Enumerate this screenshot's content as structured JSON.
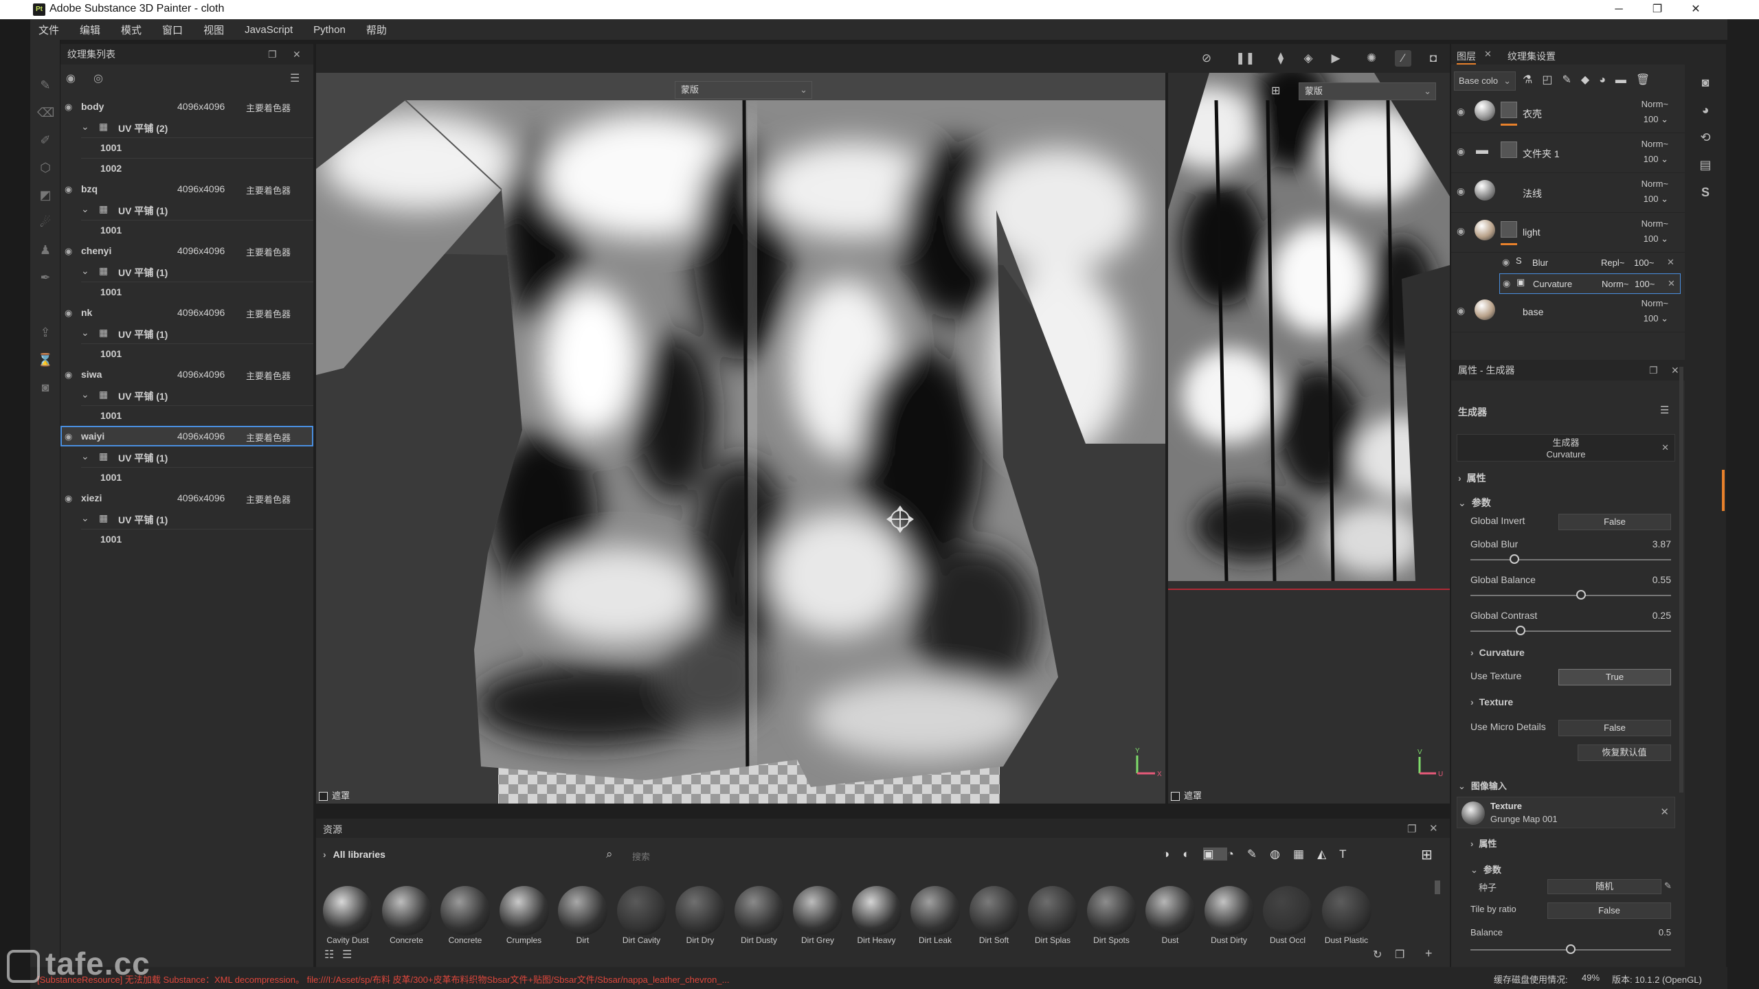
{
  "app": {
    "title": "Adobe Substance 3D Painter - cloth",
    "icon_label": "Pt",
    "window_buttons": [
      "─",
      "❐",
      "✕"
    ]
  },
  "menu": [
    "文件",
    "编辑",
    "模式",
    "窗口",
    "视图",
    "JavaScript",
    "Python",
    "帮助"
  ],
  "texture_sets": {
    "panel_title": "纹理集列表",
    "items": [
      {
        "name": "body",
        "res": "4096x4096",
        "shader": "主要着色器",
        "uv": "UV 平铺 (2)",
        "tiles": [
          "1001",
          "1002"
        ]
      },
      {
        "name": "bzq",
        "res": "4096x4096",
        "shader": "主要着色器",
        "uv": "UV 平铺 (1)",
        "tiles": [
          "1001"
        ]
      },
      {
        "name": "chenyi",
        "res": "4096x4096",
        "shader": "主要着色器",
        "uv": "UV 平铺 (1)",
        "tiles": [
          "1001"
        ]
      },
      {
        "name": "nk",
        "res": "4096x4096",
        "shader": "主要着色器",
        "uv": "UV 平铺 (1)",
        "tiles": [
          "1001"
        ]
      },
      {
        "name": "siwa",
        "res": "4096x4096",
        "shader": "主要着色器",
        "uv": "UV 平铺 (1)",
        "tiles": [
          "1001"
        ]
      },
      {
        "name": "waiyi",
        "res": "4096x4096",
        "shader": "主要着色器",
        "uv": "UV 平铺 (1)",
        "tiles": [
          "1001"
        ],
        "selected": true
      },
      {
        "name": "xiezi",
        "res": "4096x4096",
        "shader": "主要着色器",
        "uv": "UV 平铺 (1)",
        "tiles": [
          "1001"
        ]
      }
    ]
  },
  "viewport": {
    "view3d_mode": "蒙版",
    "view2d_mode": "蒙版",
    "mask_label_3d": "遮罩",
    "mask_label_2d": "遮罩"
  },
  "assets": {
    "title": "资源",
    "library": "All libraries",
    "search_placeholder": "搜索",
    "items": [
      "Cavity Dust",
      "Concrete",
      "Concrete",
      "Crumples",
      "Dirt",
      "Dirt Cavity",
      "Dirt Dry",
      "Dirt Dusty",
      "Dirt Grey",
      "Dirt Heavy",
      "Dirt Leak",
      "Dirt Soft",
      "Dirt Splas",
      "Dirt Spots",
      "Dust",
      "Dust Dirty",
      "Dust Occl",
      "Dust Plastic"
    ]
  },
  "layers": {
    "tab_layers": "图层",
    "tab_settings": "纹理集设置",
    "channel": "Base colo",
    "items": [
      {
        "name": "衣壳",
        "blend": "Norm",
        "opacity": "100",
        "ball": "#9a9a9a",
        "mask": true,
        "orange": true
      },
      {
        "name": "文件夹 1",
        "blend": "Norm",
        "opacity": "100",
        "ball": "folder",
        "mask": true,
        "orange": false
      },
      {
        "name": "法线",
        "blend": "Norm",
        "opacity": "100",
        "ball": "#8c8c8c",
        "mask": false,
        "orange": false
      },
      {
        "name": "light",
        "blend": "Norm",
        "opacity": "100",
        "ball": "#b9a28a",
        "mask": true,
        "orange": true
      },
      {
        "name": "base",
        "blend": "Norm",
        "opacity": "100",
        "ball": "#b9a28a",
        "mask": false,
        "orange": false
      }
    ],
    "sublayers": [
      {
        "name": "Blur",
        "blend": "Repl",
        "opacity": "100"
      },
      {
        "name": "Curvature",
        "blend": "Norm",
        "opacity": "100"
      }
    ]
  },
  "properties": {
    "panel_title": "属性 - 生成器",
    "section": "生成器",
    "generator_type": "生成器",
    "generator_name": "Curvature",
    "attr": "属性",
    "params": "参数",
    "global_invert_label": "Global Invert",
    "global_invert": "False",
    "global_blur_label": "Global Blur",
    "global_blur": "3.87",
    "global_blur_pos": 0.22,
    "global_balance_label": "Global Balance",
    "global_balance": "0.55",
    "global_balance_pos": 0.55,
    "global_contrast_label": "Global Contrast",
    "global_contrast": "0.25",
    "global_contrast_pos": 0.25,
    "curvature_group": "Curvature",
    "use_texture_label": "Use Texture",
    "use_texture": "True",
    "texture_group": "Texture",
    "use_micro_label": "Use Micro Details",
    "use_micro": "False",
    "reset_label": "恢复默认值",
    "image_input": "图像输入",
    "texture_name": "Texture",
    "texture_value": "Grunge Map 001",
    "attr2": "属性",
    "params2": "参数",
    "seed_label": "种子",
    "seed_value": "随机",
    "tile_label": "Tile by ratio",
    "tile_value": "False",
    "balance_label": "Balance",
    "balance_value": "0.5",
    "balance_pos": 0.5
  },
  "status": {
    "error": "[SubstanceResource] 无法加载 Substance：XML decompression。 file:///I:/Asset/sp/布料 皮革/300+皮革布料织物Sbsar文件+贴图/Sbsar文件/Sbsar/nappa_leather_chevron_...",
    "cache": "缓存磁盘使用情况:",
    "cache_pct": "49%",
    "version": "版本: 10.1.2 (OpenGL)"
  },
  "watermark": "tafe.cc"
}
